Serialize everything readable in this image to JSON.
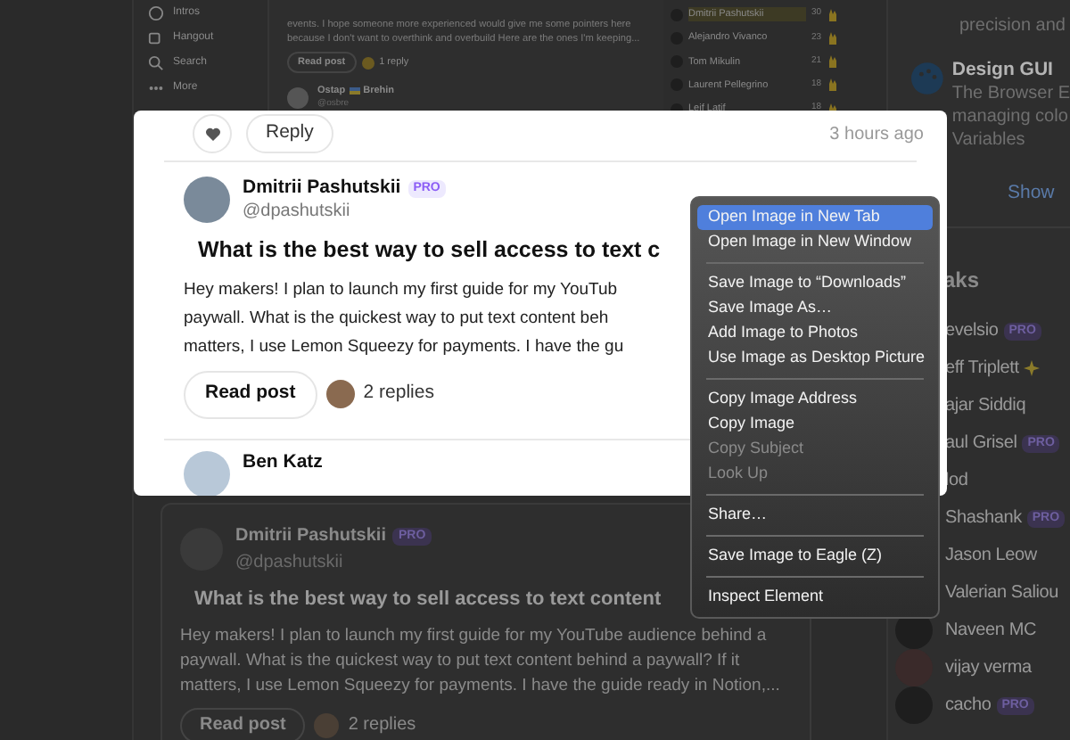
{
  "sidebar": {
    "items": [
      {
        "label": "Intros"
      },
      {
        "label": "Hangout"
      },
      {
        "label": "Search"
      },
      {
        "label": "More"
      }
    ]
  },
  "feed_top": {
    "lines": [
      "events. I hope someone more experienced would give me some pointers here",
      "because I don't want to overthink and overbuild Here are the ones I'm keeping..."
    ],
    "read_button": "Read post",
    "replies": "1 reply",
    "next_author": {
      "first": "Ostap",
      "last": "Brehin",
      "handle": "@osbre"
    }
  },
  "leaderboard": [
    {
      "name": "Dmitrii Pashutskii",
      "points": "30",
      "highlight": true
    },
    {
      "name": "Alejandro Vivanco",
      "points": "23",
      "highlight": false
    },
    {
      "name": "Tom Mikulin",
      "points": "21",
      "highlight": false
    },
    {
      "name": "Laurent Pellegrino",
      "points": "18",
      "highlight": false
    },
    {
      "name": "Leif Latif",
      "points": "18",
      "highlight": false
    }
  ],
  "right_panel": {
    "text_top": "precision and",
    "product": {
      "name": "Design GUI",
      "lines": [
        "The Browser E",
        "managing colo",
        "Variables"
      ]
    },
    "link": "Show",
    "streaks_heading": "aks",
    "members": [
      {
        "name": "evelsio",
        "badge": {
          "kind": "pro",
          "text": "PRO"
        }
      },
      {
        "name": "eff Triplett",
        "badge": {
          "kind": "sparkle"
        }
      },
      {
        "name": "ajar Siddiq"
      },
      {
        "name": "aul Grisel",
        "badge": {
          "kind": "pro",
          "text": "PRO"
        }
      },
      {
        "name": "lod"
      },
      {
        "name": "Shashank",
        "badge": {
          "kind": "pro",
          "text": "PRO"
        }
      },
      {
        "name": "Jason Leow"
      },
      {
        "name": "Valerian Saliou"
      },
      {
        "name": "Naveen MC"
      },
      {
        "name": "vijay verma"
      },
      {
        "name": "cacho",
        "badge": {
          "kind": "pro",
          "text": "PRO"
        }
      }
    ]
  },
  "feed_bottom": {
    "author": "Dmitrii Pashutskii",
    "badge": "PRO",
    "handle": "@dpashutskii",
    "title": "What is the best way to sell access to text content",
    "lines": [
      "Hey makers! I plan to launch my first guide for my YouTube audience behind a",
      "paywall. What is the quickest way to put text content behind a paywall? If it",
      "matters, I use Lemon Squeezy for payments. I have the guide ready in Notion,..."
    ],
    "read_button": "Read post",
    "replies": "2 replies"
  },
  "popup": {
    "reply_button": "Reply",
    "time": "3 hours ago",
    "post": {
      "author": "Dmitrii Pashutskii",
      "badge": "PRO",
      "handle": "@dpashutskii",
      "title": "What is the best way to sell access to text c",
      "lines": [
        "Hey makers! I plan to launch my first guide for my YouTub",
        "paywall. What is the quickest way to put text content beh",
        "matters, I use Lemon Squeezy for payments. I have the gu"
      ],
      "read_button": "Read post",
      "replies": "2 replies"
    },
    "next_author": "Ben Katz"
  },
  "context_menu": {
    "groups": [
      [
        {
          "label": "Open Image in New Tab",
          "selected": true,
          "disabled": false
        },
        {
          "label": "Open Image in New Window",
          "selected": false,
          "disabled": false
        }
      ],
      [
        {
          "label": "Save Image to “Downloads”",
          "selected": false,
          "disabled": false
        },
        {
          "label": "Save Image As…",
          "selected": false,
          "disabled": false
        },
        {
          "label": "Add Image to Photos",
          "selected": false,
          "disabled": false
        },
        {
          "label": "Use Image as Desktop Picture",
          "selected": false,
          "disabled": false
        }
      ],
      [
        {
          "label": "Copy Image Address",
          "selected": false,
          "disabled": false
        },
        {
          "label": "Copy Image",
          "selected": false,
          "disabled": false
        },
        {
          "label": "Copy Subject",
          "selected": false,
          "disabled": true
        },
        {
          "label": "Look Up",
          "selected": false,
          "disabled": true
        }
      ],
      [
        {
          "label": "Share…",
          "selected": false,
          "disabled": false
        }
      ],
      [
        {
          "label": "Save Image to Eagle (Z)",
          "selected": false,
          "disabled": false
        }
      ],
      [
        {
          "label": "Inspect Element",
          "selected": false,
          "disabled": false
        }
      ]
    ]
  }
}
